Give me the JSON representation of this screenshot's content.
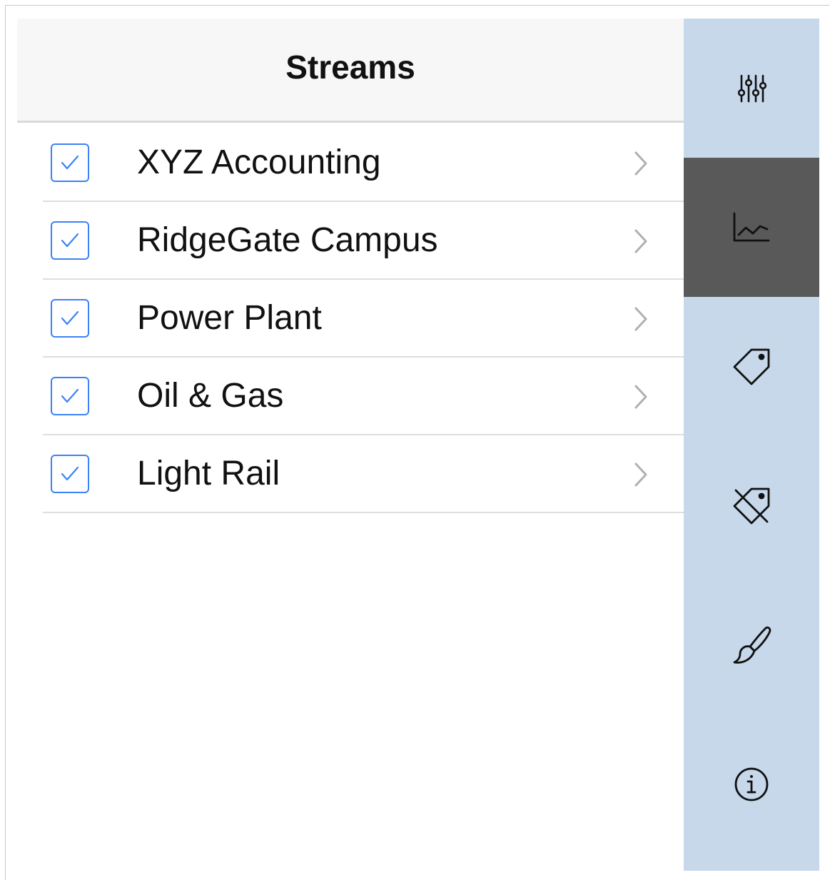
{
  "header": {
    "title": "Streams"
  },
  "streams": [
    {
      "label": "XYZ Accounting",
      "checked": true
    },
    {
      "label": "RidgeGate Campus",
      "checked": true
    },
    {
      "label": "Power Plant",
      "checked": true
    },
    {
      "label": "Oil & Gas",
      "checked": true
    },
    {
      "label": "Light Rail",
      "checked": true
    }
  ],
  "sidebar": {
    "items": [
      {
        "icon": "sliders-icon",
        "active": false
      },
      {
        "icon": "line-chart-icon",
        "active": true
      },
      {
        "icon": "tag-icon",
        "active": false
      },
      {
        "icon": "tag-off-icon",
        "active": false
      },
      {
        "icon": "paintbrush-icon",
        "active": false
      },
      {
        "icon": "info-icon",
        "active": false
      }
    ]
  },
  "colors": {
    "checkbox_accent": "#3b82f6",
    "sidebar_bg": "#c7d8ea",
    "sidebar_active_bg": "#595959",
    "header_bg": "#f7f7f7"
  }
}
